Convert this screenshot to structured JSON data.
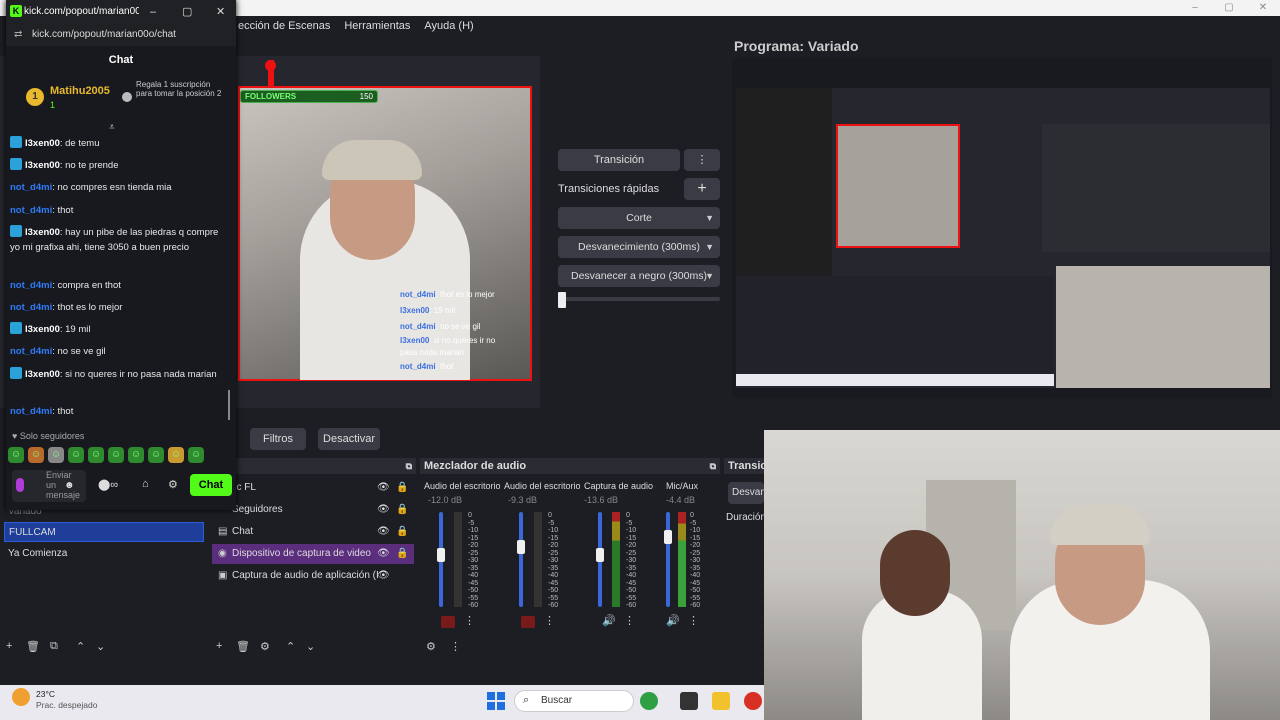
{
  "obs": {
    "menu": [
      "ección de Escenas",
      "Herramientas",
      "Ayuda (H)"
    ],
    "window_controls": [
      "–",
      "▢",
      "✕"
    ],
    "preview": {
      "followers_label": "FOLLOWERS",
      "followers_count": "150",
      "overlay_chat": [
        {
          "user": "not_d4mi",
          "text": ": thot es lo mejor"
        },
        {
          "user": "l3xen00",
          "text": ": 19 mil"
        },
        {
          "user": "not_d4mi",
          "text": ": no se ve gil"
        },
        {
          "user": "l3xen00",
          "text": ": si no queres ir no"
        },
        {
          "user": "",
          "text": "pasa nada marian"
        },
        {
          "user": "not_d4mi",
          "text": ": thot"
        }
      ]
    },
    "transitions": {
      "transition_label": "Transición",
      "menu_icon": "⋮",
      "quick_label": "Transiciones rápidas",
      "add_icon": "+",
      "items": [
        "Corte",
        "Desvanecimiento (300ms)",
        "Desvanecer a negro (300ms)"
      ],
      "tbar_level": 0
    },
    "program_title": "Programa: Variado",
    "toolbar": {
      "filters_label": "Filtros",
      "deactivate_label": "Desactivar"
    },
    "scenes": {
      "items": [
        "Variado",
        "FULLCAM",
        "Ya Comienza"
      ],
      "selected": "FULLCAM"
    },
    "sources": {
      "header": "tes",
      "items": [
        "lic FL",
        "Seguidores",
        "Chat",
        "Dispositivo de captura de video",
        "Captura de audio de aplicación (I"
      ],
      "selected": "Dispositivo de captura de video"
    },
    "mixer": {
      "header": "Mezclador de audio",
      "channels": [
        {
          "name": "Audio del escritorio",
          "db": "-12.0 dB",
          "level": 0.55
        },
        {
          "name": "Audio del escritorio",
          "db": "-9.3 dB",
          "level": 0.65
        },
        {
          "name": "Captura de audio c",
          "db": "-13.6 dB",
          "level": 0.55
        },
        {
          "name": "Mic/Aux",
          "db": "-4.4 dB",
          "level": 0.78
        }
      ],
      "scale": [
        "0",
        "-5",
        "-10",
        "-15",
        "-20",
        "-25",
        "-30",
        "-35",
        "-40",
        "-45",
        "-50",
        "-55",
        "-60"
      ]
    },
    "trans_dock": {
      "header": "Transic",
      "item": "Desvan",
      "duration": "Duración"
    },
    "dock_icons": [
      "+",
      "🗑",
      "⧉",
      "⌃",
      "⌄",
      "⚙"
    ]
  },
  "kick": {
    "window_title": "kick.com/popout/marian00...",
    "url": "kick.com/popout/marian00o/chat",
    "chat_header": "Chat",
    "pinned": {
      "rank": "1",
      "user": "Matihu2005",
      "count": "1",
      "text": "Regala 1 suscripción para tomar la posición 2"
    },
    "messages": [
      {
        "user": "l3xen00",
        "badge": true,
        "text": ": de temu"
      },
      {
        "user": "l3xen00",
        "badge": true,
        "text": ": no te prende"
      },
      {
        "user": "not_d4mi",
        "badge": false,
        "text": ": no compres esn tienda mia"
      },
      {
        "user": "not_d4mi",
        "badge": false,
        "text": ": thot"
      },
      {
        "user": "l3xen00",
        "badge": true,
        "text": ": hay un pibe de las piedras q compre yo mi grafixa ahi, tiene 3050 a buen precio"
      },
      {
        "user": "not_d4mi",
        "badge": false,
        "text": ": compra en thot"
      },
      {
        "user": "not_d4mi",
        "badge": false,
        "text": ": thot es lo mejor"
      },
      {
        "user": "l3xen00",
        "badge": true,
        "text": ": 19 mil"
      },
      {
        "user": "not_d4mi",
        "badge": false,
        "text": ": no se ve gil"
      },
      {
        "user": "l3xen00",
        "badge": true,
        "text": ": si no queres ir no pasa nada marian"
      },
      {
        "user": "not_d4mi",
        "badge": false,
        "text": ": thot"
      }
    ],
    "followers_only": "♥ Solo seguidores",
    "input_placeholder": "Enviar un mensaje",
    "send_label": "Chat"
  },
  "taskbar": {
    "temp": "23°C",
    "weather": "Prac. despejado",
    "search_placeholder": "Buscar"
  }
}
